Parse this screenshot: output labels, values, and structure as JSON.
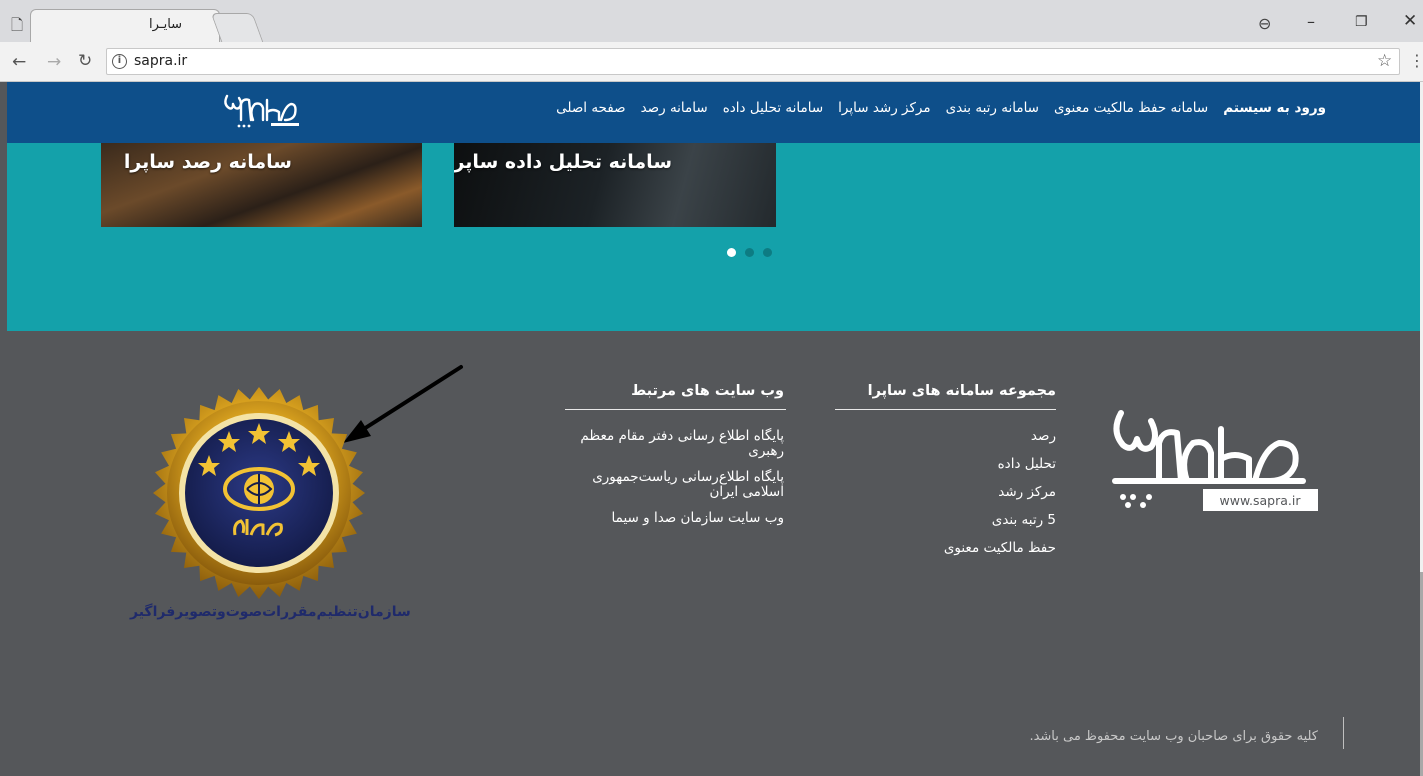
{
  "browser": {
    "tab_title": "سایـرا",
    "tab_close": "✕",
    "url": "sapra.ir",
    "icons": {
      "page": "page-icon",
      "back": "back-arrow-icon",
      "forward": "forward-arrow-icon",
      "reload": "reload-icon",
      "info": "info-icon",
      "star": "bookmark-star-icon",
      "menu": "kebab-menu-icon",
      "profile": "profile-icon"
    },
    "window_controls": {
      "minimize": "–",
      "maximize": "❐",
      "close": "✕"
    }
  },
  "header": {
    "logo_alt": "سایـرا",
    "nav": [
      "صفحه اصلی",
      "سامانه رصد",
      "سامانه تحلیل داده",
      "مرکز رشد ساپرا",
      "سامانه رتبه بندی",
      "سامانه حفظ مالکیت معنوی"
    ],
    "login": "ورود به سیستم",
    "color": "#0e4f8a"
  },
  "slider": {
    "color": "#14a1aa",
    "cards": [
      {
        "title": "سامانه رصد ساپرا"
      },
      {
        "title": "سامانه تحلیل داده ساپرا"
      }
    ],
    "dots": 3,
    "active_dot": 0
  },
  "footer": {
    "color": "#55575a",
    "systems": {
      "heading": "مجموعه سامانه های ساپرا",
      "items": [
        "رصد",
        "تحلیل داده",
        "مرکز رشد",
        "5 رتبه بندی",
        "حفظ مالکیت معنوی"
      ]
    },
    "related": {
      "heading": "وب سایت های مرتبط",
      "items": [
        "پایگاه اطلاع رسانی دفتر مقام معظم رهبری",
        "پایگاه اطلاع‌رسانی ریاست‌جمهوری اسلامی ایران",
        "وب سایت سازمان صدا و سیما"
      ]
    },
    "logo_url_text": "www.sapra.ir",
    "badge_caption": "سازمان‌تنظیم‌مقررات‌صوت‌وتصویر‌فراگیر",
    "copyright": "کلیه حقوق برای صاحبان وب سایت محفوظ می باشد."
  }
}
